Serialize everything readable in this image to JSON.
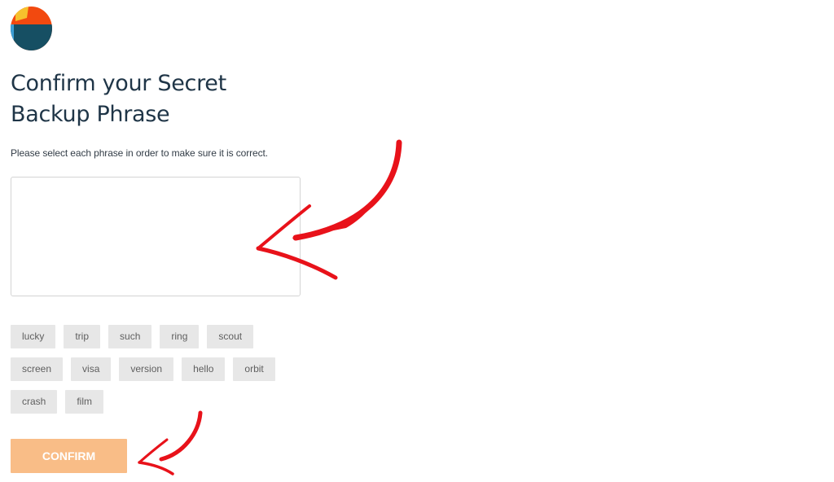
{
  "logo": {
    "icon": "metamask-fox-logo-icon",
    "colors": {
      "top": "#f2490f",
      "accent": "#f6c12d",
      "bottom": "#164f63",
      "edge": "#3c9fd6"
    }
  },
  "header": {
    "title_line1": "Confirm your Secret",
    "title_line2": "Backup Phrase"
  },
  "instructions": "Please select each phrase in order to make sure it is correct.",
  "phrase_box": {
    "value": ""
  },
  "word_chips": {
    "rows": [
      [
        "lucky",
        "trip",
        "such",
        "ring",
        "scout"
      ],
      [
        "screen",
        "visa",
        "version",
        "hello",
        "orbit"
      ],
      [
        "crash",
        "film"
      ]
    ]
  },
  "confirm_button": {
    "label": "CONFIRM",
    "color": "#f9bd87"
  },
  "annotations": {
    "arrow_color": "#e8121a",
    "arrows": [
      "arrow-to-phrase-box",
      "arrow-to-confirm-button"
    ]
  }
}
